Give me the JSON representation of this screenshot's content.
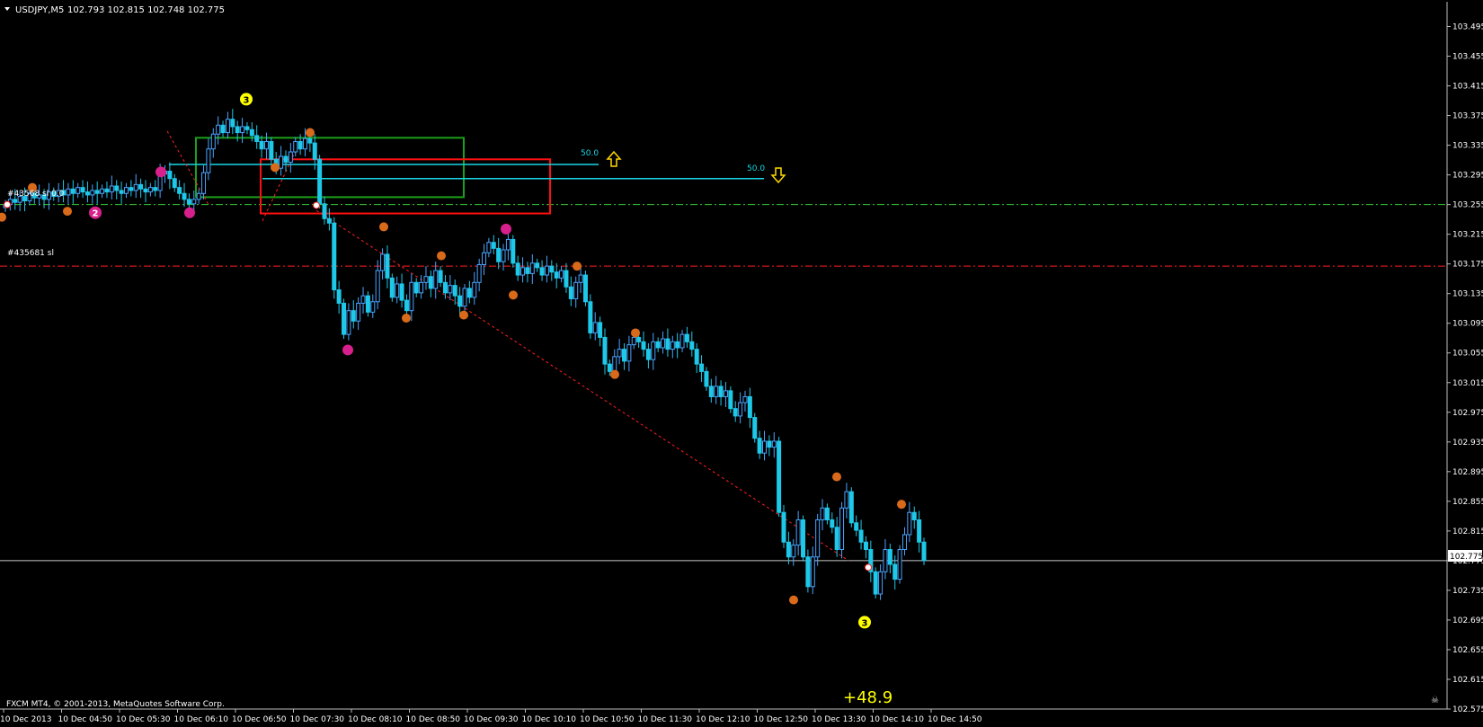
{
  "header": {
    "symbol": "USDJPY,M5",
    "ohlc": "102.793 102.815 102.748 102.775"
  },
  "copyright": "FXCM MT4, © 2001-2013, MetaQuotes Software Corp.",
  "profit_label": "+48.9",
  "current_price_label": "102.775",
  "order_lines": [
    {
      "label": "#43568 sl 0.0",
      "price": 103.255,
      "color": "#32cd32"
    },
    {
      "label": "#435681 sl",
      "price": 103.172,
      "color": "#ff2020"
    }
  ],
  "fib_labels": [
    {
      "text": "50.0",
      "price": 103.309
    },
    {
      "text": "50.0",
      "price": 103.29
    }
  ],
  "arrows": [
    {
      "direction": "up",
      "color": "#ffd700"
    },
    {
      "direction": "down",
      "color": "#ffd700"
    }
  ],
  "colors": {
    "background": "#000000",
    "candle_up": "#4aa3ff",
    "candle_down": "#1ec8e8",
    "grid_text": "#ffffff",
    "rect_green": "#1aa01a",
    "rect_red": "#ff1010",
    "cyan_line": "#19d6e6",
    "yellow": "#ffff00",
    "orange_marker": "#d86a1a",
    "magenta_marker": "#d8208c"
  },
  "chart_data": {
    "type": "candlestick",
    "title": "USDJPY,M5",
    "ylim": [
      102.575,
      103.515
    ],
    "y_ticks": [
      "103.495",
      "103.455",
      "103.415",
      "103.375",
      "103.335",
      "103.295",
      "103.255",
      "103.215",
      "103.175",
      "103.135",
      "103.095",
      "103.055",
      "103.015",
      "102.975",
      "102.935",
      "102.895",
      "102.855",
      "102.815",
      "102.775",
      "102.735",
      "102.695",
      "102.655",
      "102.615",
      "102.575"
    ],
    "x_ticks": [
      "10 Dec 2013",
      "10 Dec 04:50",
      "10 Dec 05:30",
      "10 Dec 06:10",
      "10 Dec 06:50",
      "10 Dec 07:30",
      "10 Dec 08:10",
      "10 Dec 08:50",
      "10 Dec 09:30",
      "10 Dec 10:10",
      "10 Dec 10:50",
      "10 Dec 11:30",
      "10 Dec 12:10",
      "10 Dec 12:50",
      "10 Dec 13:30",
      "10 Dec 14:10",
      "10 Dec 14:50"
    ],
    "series": [
      {
        "name": "USDJPY,M5",
        "close": [
          103.255,
          103.262,
          103.258,
          103.266,
          103.26,
          103.27,
          103.264,
          103.268,
          103.262,
          103.272,
          103.266,
          103.274,
          103.268,
          103.276,
          103.27,
          103.278,
          103.272,
          103.268,
          103.274,
          103.27,
          103.276,
          103.272,
          103.28,
          103.274,
          103.27,
          103.278,
          103.274,
          103.282,
          103.276,
          103.272,
          103.278,
          103.274,
          103.296,
          103.3,
          103.29,
          103.278,
          103.27,
          103.262,
          103.256,
          103.262,
          103.27,
          103.298,
          103.33,
          103.35,
          103.362,
          103.352,
          103.37,
          103.36,
          103.352,
          103.36,
          103.356,
          103.348,
          103.34,
          103.33,
          103.34,
          103.316,
          103.304,
          103.32,
          103.312,
          103.326,
          103.34,
          103.33,
          103.344,
          103.338,
          103.316,
          103.256,
          103.236,
          103.23,
          103.14,
          103.122,
          103.08,
          103.112,
          103.098,
          103.122,
          103.132,
          103.11,
          103.124,
          103.166,
          103.188,
          103.156,
          103.13,
          103.148,
          103.126,
          103.112,
          103.15,
          103.136,
          103.15,
          103.158,
          103.142,
          103.166,
          103.15,
          103.136,
          103.146,
          103.132,
          103.118,
          103.142,
          103.13,
          103.15,
          103.174,
          103.19,
          103.204,
          103.196,
          103.178,
          103.194,
          103.208,
          103.176,
          103.16,
          103.17,
          103.162,
          103.176,
          103.17,
          103.16,
          103.172,
          103.164,
          103.156,
          103.166,
          103.144,
          103.128,
          103.15,
          103.16,
          103.124,
          103.082,
          103.096,
          103.076,
          103.04,
          103.03,
          103.05,
          103.06,
          103.044,
          103.066,
          103.076,
          103.07,
          103.06,
          103.046,
          103.07,
          103.062,
          103.074,
          103.06,
          103.07,
          103.062,
          103.08,
          103.07,
          103.06,
          103.04,
          103.03,
          103.01,
          102.996,
          103.01,
          102.996,
          103.004,
          102.98,
          102.97,
          102.988,
          102.996,
          102.968,
          102.94,
          102.92,
          102.936,
          102.928,
          102.936,
          102.84,
          102.8,
          102.78,
          102.796,
          102.83,
          102.78,
          102.74,
          102.78,
          102.83,
          102.846,
          102.83,
          102.82,
          102.79,
          102.846,
          102.868,
          102.826,
          102.816,
          102.8,
          102.79,
          102.76,
          102.73,
          102.76,
          102.79,
          102.77,
          102.75,
          102.79,
          102.81,
          102.84,
          102.83,
          102.8,
          102.775
        ]
      }
    ],
    "annotations": [
      "3",
      "2",
      "3"
    ],
    "horizontal_levels": [
      103.255,
      103.172,
      102.775
    ],
    "grid": false
  }
}
